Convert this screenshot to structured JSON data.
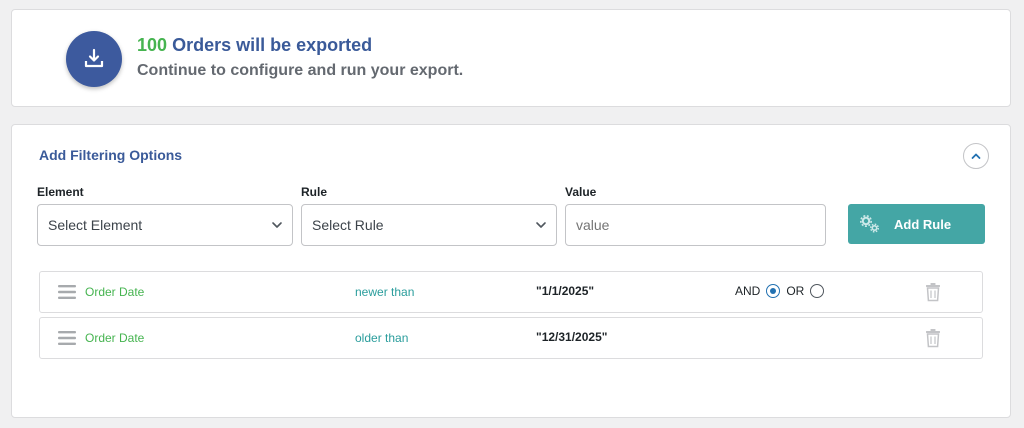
{
  "summary": {
    "count": "100",
    "headline_rest": "Orders will be exported",
    "subline": "Continue to configure and run your export.",
    "icon": "download-tray-icon"
  },
  "filters": {
    "title": "Add Filtering Options",
    "collapse_icon": "chevron-up-icon",
    "fields": {
      "element_label": "Element",
      "element_selected": "Select Element",
      "rule_label": "Rule",
      "rule_selected": "Select Rule",
      "value_label": "Value",
      "value_placeholder": "value"
    },
    "add_rule_label": "Add Rule",
    "rules": [
      {
        "element": "Order Date",
        "rule": "newer than",
        "value": "\"1/1/2025\"",
        "and_label": "AND",
        "or_label": "OR",
        "selected": "AND"
      },
      {
        "element": "Order Date",
        "rule": "older than",
        "value": "\"12/31/2025\""
      }
    ]
  },
  "colors": {
    "accent_blue": "#3a5a99",
    "green": "#46b450",
    "teal": "#44a6a5"
  }
}
